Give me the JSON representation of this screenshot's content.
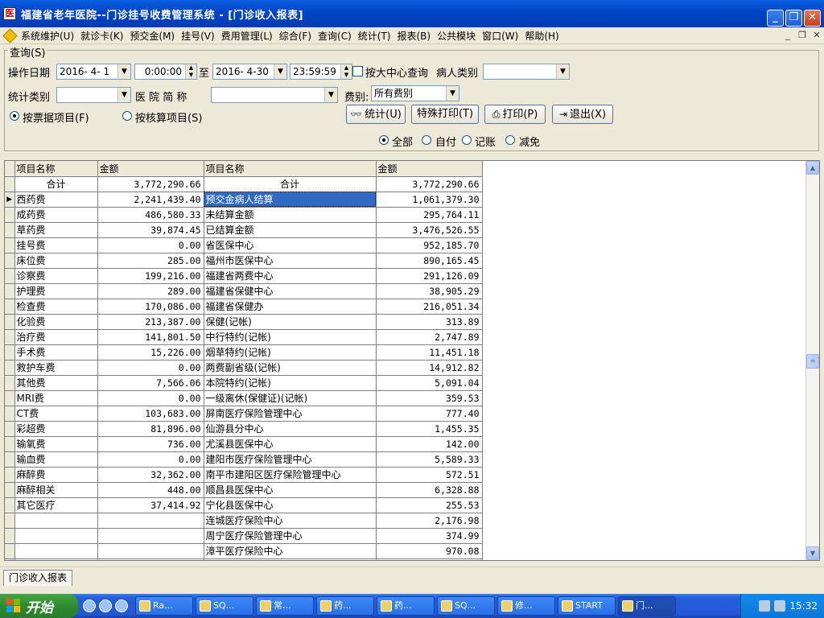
{
  "window": {
    "title": "福建省老年医院--门诊挂号收费管理系统 - [门诊收入报表]",
    "app_icon_glyph": "医"
  },
  "menu": {
    "items": [
      "系统维护(U)",
      "就诊卡(K)",
      "预交金(M)",
      "挂号(V)",
      "费用管理(L)",
      "综合(F)",
      "查询(C)",
      "统计(T)",
      "报表(B)",
      "公共模块",
      "窗口(W)",
      "帮助(H)"
    ]
  },
  "query": {
    "legend": "查询(S)",
    "op_date_label": "操作日期",
    "start_date": "2016- 4- 1",
    "start_time": "0:00:00",
    "to_label": "至",
    "end_date": "2016- 4-30",
    "end_time": "23:59:59",
    "center_query_label": "按大中心查询",
    "patient_type_label": "病人类别",
    "patient_type_value": "",
    "stat_type_label": "统计类别",
    "stat_type_value": "",
    "hospital_label": "医 院 简 称",
    "hospital_value": "",
    "fee_type_label": "费别:",
    "fee_type_value": "所有费别",
    "radio_ticket": "按票据项目(F)",
    "radio_settle": "按核算项目(S)",
    "btn_stat": "统计(U)",
    "btn_special_print": "特殊打印(T)",
    "btn_print": "打印(P)",
    "btn_exit": "退出(X)",
    "pay_all": "全部",
    "pay_self": "自付",
    "pay_account": "记账",
    "pay_relief": "减免"
  },
  "grid": {
    "headers": [
      "项目名称",
      "金额",
      "项目名称",
      "金额"
    ],
    "rows": [
      [
        "合计",
        "3,772,290.66",
        "合计",
        "3,772,290.66"
      ],
      [
        "西药费",
        "2,241,439.40",
        "预交金病人结算",
        "1,061,379.30"
      ],
      [
        "成药费",
        "486,580.33",
        "未结算金额",
        "295,764.11"
      ],
      [
        "草药费",
        "39,874.45",
        "已结算金额",
        "3,476,526.55"
      ],
      [
        "挂号费",
        "0.00",
        "省医保中心",
        "952,185.70"
      ],
      [
        "床位费",
        "285.00",
        "福州市医保中心",
        "890,165.45"
      ],
      [
        "诊察费",
        "199,216.00",
        "福建省两费中心",
        "291,126.09"
      ],
      [
        "护理费",
        "289.00",
        "福建省保健中心",
        "38,905.29"
      ],
      [
        "检查费",
        "170,086.00",
        "福建省保健办",
        "216,051.34"
      ],
      [
        "化验费",
        "213,387.00",
        "保健(记帐)",
        "313.89"
      ],
      [
        "治疗费",
        "141,801.50",
        "中行特约(记帐)",
        "2,747.89"
      ],
      [
        "手术费",
        "15,226.00",
        "烟草特约(记帐)",
        "11,451.18"
      ],
      [
        "救护车费",
        "0.00",
        "两费副省级(记帐)",
        "14,912.82"
      ],
      [
        "其他费",
        "7,566.06",
        "本院特约(记帐)",
        "5,091.04"
      ],
      [
        "MRI费",
        "0.00",
        "一级离休(保健证)(记帐)",
        "359.53"
      ],
      [
        "CT费",
        "103,683.00",
        "屏南医疗保险管理中心",
        "777.40"
      ],
      [
        "彩超费",
        "81,896.00",
        "仙游县分中心",
        "1,455.35"
      ],
      [
        "输氧费",
        "736.00",
        "尤溪县医保中心",
        "142.00"
      ],
      [
        "输血费",
        "0.00",
        "建阳市医疗保险管理中心",
        "5,589.33"
      ],
      [
        "麻醉费",
        "32,362.00",
        "南平市建阳区医疗保险管理中心",
        "572.51"
      ],
      [
        "麻醉相关",
        "448.00",
        "顺昌县医保中心",
        "6,328.88"
      ],
      [
        "其它医疗",
        "37,414.92",
        "宁化县医保中心",
        "255.53"
      ],
      [
        "",
        "",
        "连城医疗保险中心",
        "2,176.98"
      ],
      [
        "",
        "",
        "周宁医疗保险管理中心",
        "374.99"
      ],
      [
        "",
        "",
        "漳平医疗保险中心",
        "970.08"
      ]
    ]
  },
  "bottom_tab": "门诊收入报表",
  "taskbar": {
    "start_label": "开始",
    "tasks": [
      "Ra...",
      "SQ...",
      "常...",
      "药...",
      "药...",
      "SQ...",
      "修...",
      "START",
      "门..."
    ],
    "clock": "15:32"
  }
}
